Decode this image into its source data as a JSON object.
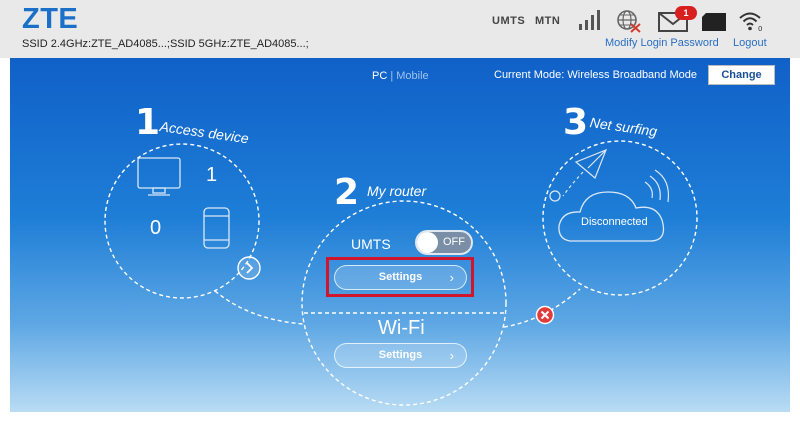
{
  "header": {
    "logo": "ZTE",
    "ssid": "SSID 2.4GHz:ZTE_AD4085...;SSID 5GHz:ZTE_AD4085...;",
    "network_type": "UMTS",
    "operator": "MTN",
    "mail_count": "1",
    "links": {
      "modify_password": "Modify Login Password",
      "logout": "Logout"
    },
    "icons": [
      "signal-strength-icon",
      "globe-icon",
      "mail-icon",
      "sim-card-icon",
      "wifi-icon"
    ]
  },
  "main": {
    "view_switch": {
      "pc": "PC",
      "separator": "|",
      "mobile": "Mobile"
    },
    "mode_text": "Current Mode: Wireless Broadband Mode",
    "change_label": "Change",
    "steps": {
      "access": {
        "number": "1",
        "title": "Access device",
        "wired_count": "1",
        "wireless_count": "0"
      },
      "router": {
        "number": "2",
        "title": "My router",
        "network_label": "UMTS",
        "toggle_state": "OFF",
        "settings_label": "Settings",
        "wifi_label": "Wi-Fi",
        "wifi_settings_label": "Settings"
      },
      "surfing": {
        "number": "3",
        "title": "Net surfing",
        "status": "Disconnected"
      }
    }
  },
  "colors": {
    "brand_blue": "#1a6fc9",
    "link_blue": "#2a6fc2",
    "badge_red": "#d82020",
    "highlight_red": "#d3152b",
    "panel_top": "#1060c8",
    "panel_bottom": "#b9dcf4"
  }
}
